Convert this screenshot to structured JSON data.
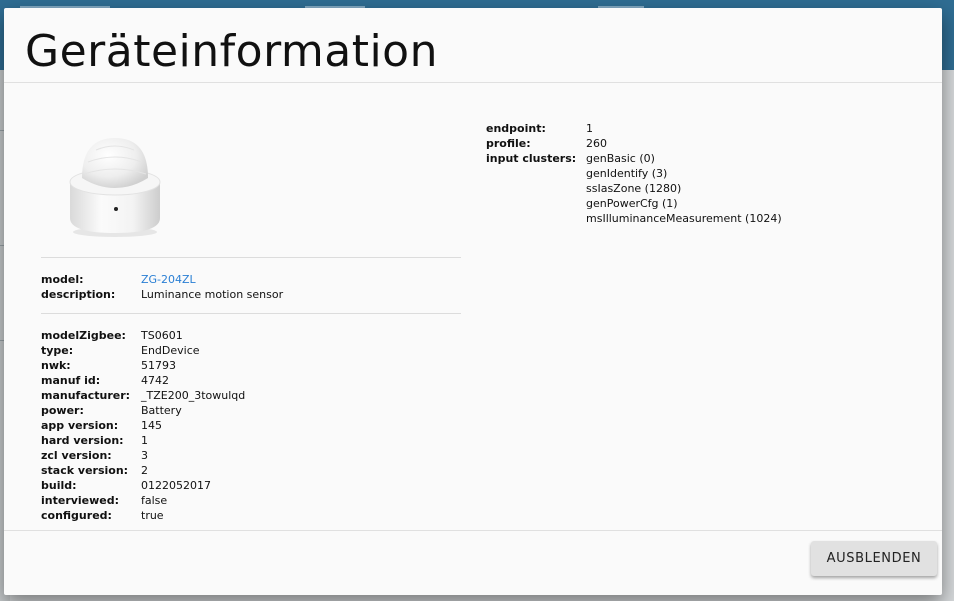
{
  "dialog": {
    "title": "Geräteinformation",
    "close_button_label": "AUSBLENDEN"
  },
  "device": {
    "model_label": "model:",
    "model_value": "ZG-204ZL",
    "description_label": "description:",
    "description_value": "Luminance motion sensor"
  },
  "details": [
    {
      "label": "modelZigbee:",
      "value": "TS0601"
    },
    {
      "label": "type:",
      "value": "EndDevice"
    },
    {
      "label": "nwk:",
      "value": "51793"
    },
    {
      "label": "manuf id:",
      "value": "4742"
    },
    {
      "label": "manufacturer:",
      "value": "_TZE200_3towulqd"
    },
    {
      "label": "power:",
      "value": "Battery"
    },
    {
      "label": "app version:",
      "value": "145"
    },
    {
      "label": "hard version:",
      "value": "1"
    },
    {
      "label": "zcl version:",
      "value": "3"
    },
    {
      "label": "stack version:",
      "value": "2"
    },
    {
      "label": "build:",
      "value": "0122052017"
    },
    {
      "label": "interviewed:",
      "value": "false"
    },
    {
      "label": "configured:",
      "value": "true"
    }
  ],
  "endpoint": {
    "endpoint_label": "endpoint:",
    "endpoint_value": "1",
    "profile_label": "profile:",
    "profile_value": "260",
    "clusters_label": "input clusters:",
    "clusters": [
      "genBasic (0)",
      "genIdentify (3)",
      "ssIasZone (1280)",
      "genPowerCfg (1)",
      "msIlluminanceMeasurement (1024)"
    ]
  }
}
